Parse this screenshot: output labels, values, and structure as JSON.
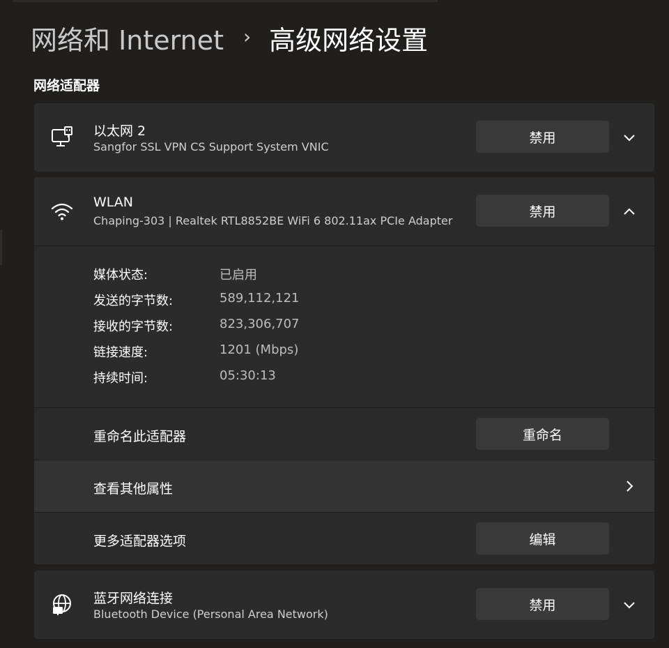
{
  "breadcrumb": {
    "parent": "网络和 Internet",
    "separator": "›",
    "current": "高级网络设置"
  },
  "section": {
    "title": "网络适配器"
  },
  "adapters": [
    {
      "name": "以太网 2",
      "description": "Sangfor SSL VPN CS Support System VNIC",
      "icon": "ethernet-icon",
      "button_label": "禁用",
      "expanded": false
    },
    {
      "name": "WLAN",
      "description": "Chaping-303 | Realtek RTL8852BE WiFi 6 802.11ax PCIe Adapter",
      "icon": "wifi-icon",
      "button_label": "禁用",
      "expanded": true,
      "details": [
        {
          "label": "媒体状态:",
          "value": "已启用"
        },
        {
          "label": "发送的字节数:",
          "value": "589,112,121"
        },
        {
          "label": "接收的字节数:",
          "value": "823,306,707"
        },
        {
          "label": "链接速度:",
          "value": "1201 (Mbps)"
        },
        {
          "label": "持续时间:",
          "value": "05:30:13"
        }
      ],
      "rename": {
        "label": "重命名此适配器",
        "button_label": "重命名"
      },
      "properties": {
        "label": "查看其他属性"
      },
      "more_options": {
        "label": "更多适配器选项",
        "button_label": "编辑"
      }
    },
    {
      "name": "蓝牙网络连接",
      "description": "Bluetooth Device (Personal Area Network)",
      "icon": "globe-network-icon",
      "button_label": "禁用",
      "expanded": false
    }
  ],
  "colors": {
    "background": "#201f1e",
    "card": "#2b2b2b",
    "button": "#3a3a3a",
    "text_primary": "#ffffff",
    "text_secondary": "#bdbdbd"
  }
}
